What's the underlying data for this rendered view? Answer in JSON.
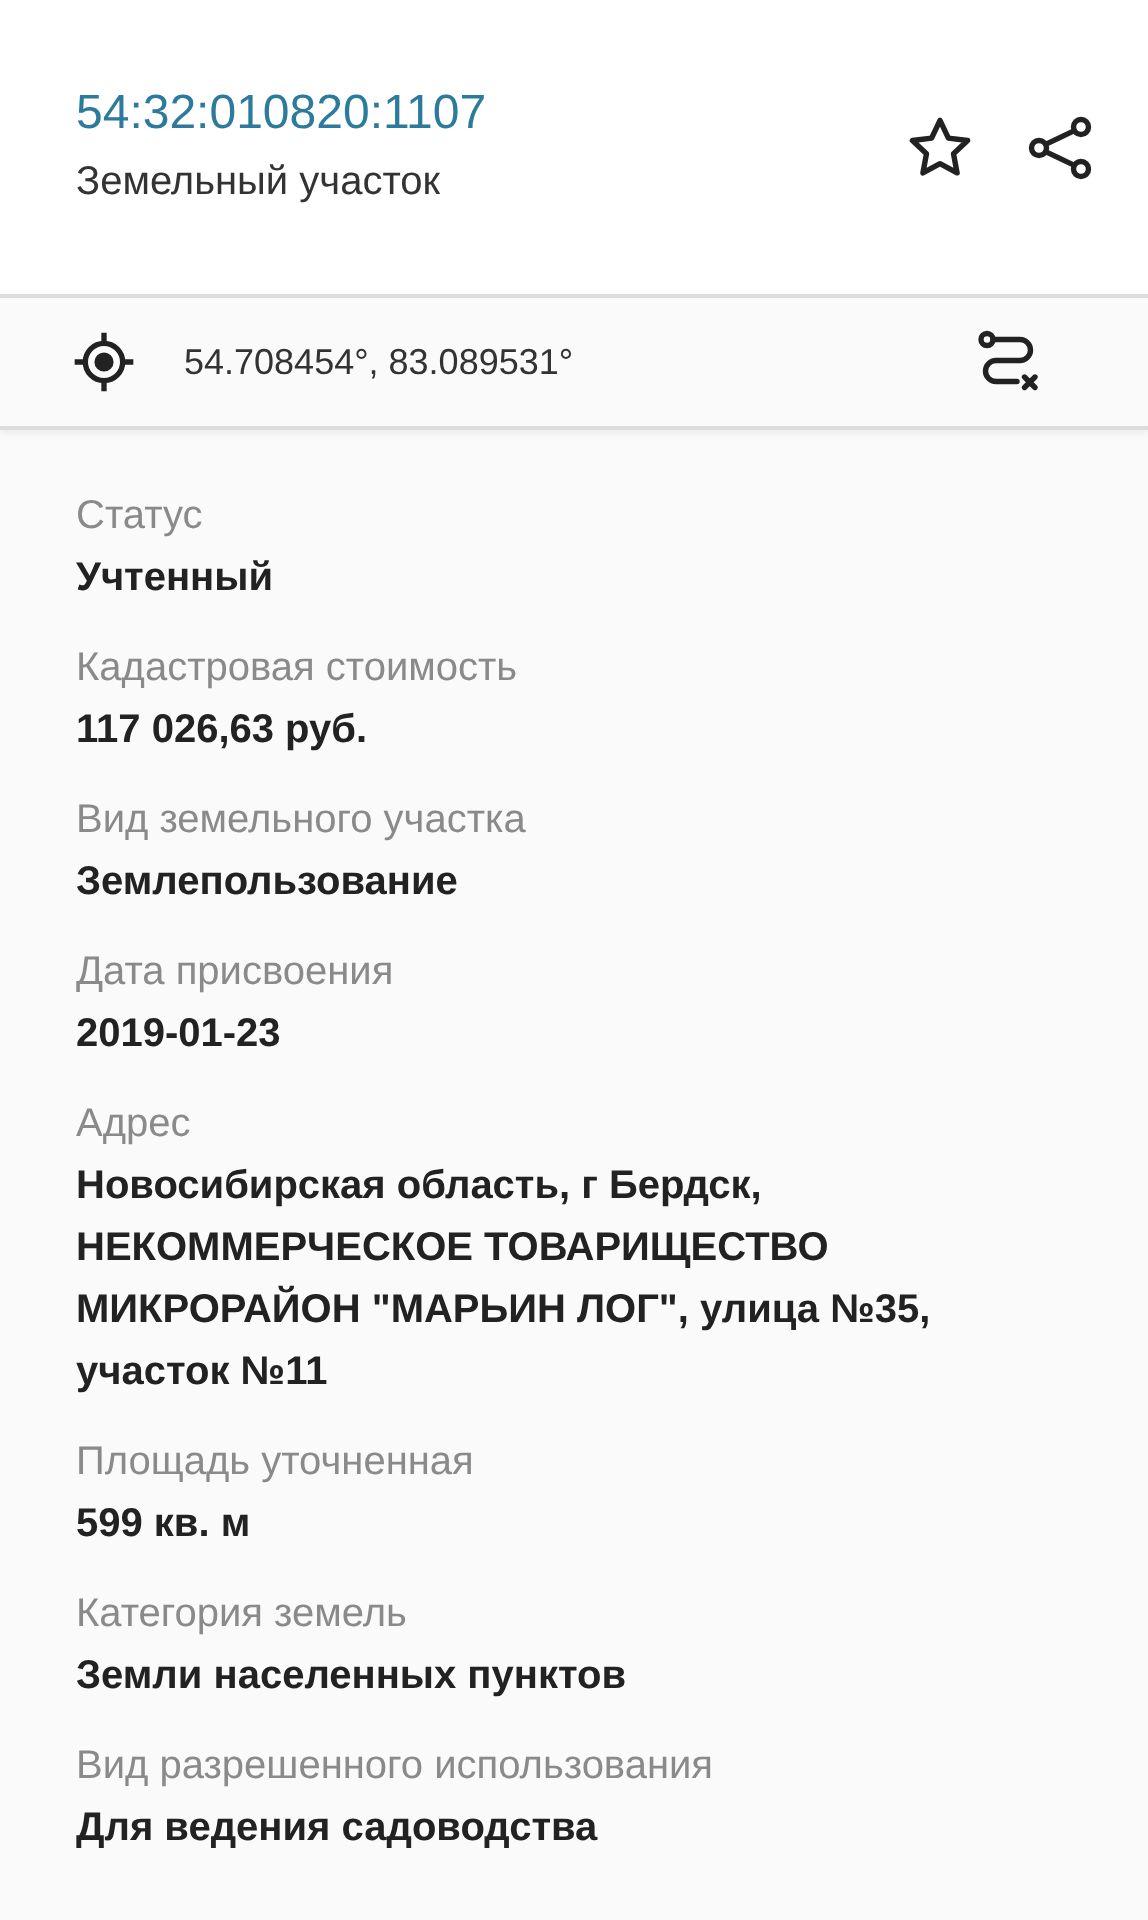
{
  "header": {
    "title": "54:32:010820:1107",
    "subtitle": "Земельный участок"
  },
  "location": {
    "coordinates": "54.708454°, 83.089531°"
  },
  "fields": [
    {
      "label": "Статус",
      "value": "Учтенный"
    },
    {
      "label": "Кадастровая стоимость",
      "value": "117 026,63 руб."
    },
    {
      "label": "Вид земельного участка",
      "value": "Землепользование"
    },
    {
      "label": "Дата присвоения",
      "value": "2019-01-23"
    },
    {
      "label": "Адрес",
      "value": "Новосибирская область, г Бердск, НЕКОММЕРЧЕСКОЕ ТОВАРИЩЕСТВО МИКРОРАЙОН \"МАРЬИН ЛОГ\", улица №35, участок №11"
    },
    {
      "label": "Площадь уточненная",
      "value": "599 кв. м"
    },
    {
      "label": "Категория земель",
      "value": "Земли населенных пунктов"
    },
    {
      "label": "Вид разрешенного использования",
      "value": "Для ведения садоводства"
    }
  ]
}
